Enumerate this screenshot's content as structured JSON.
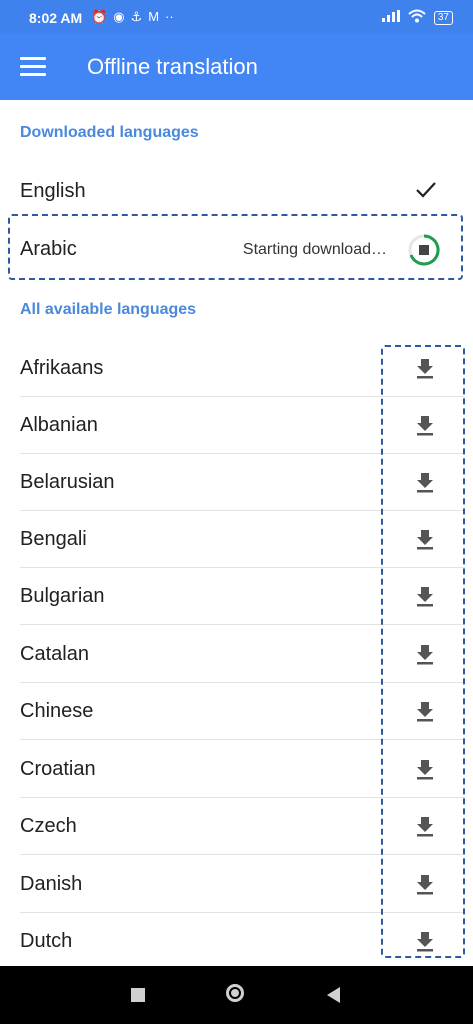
{
  "status_bar": {
    "time": "8:02 AM",
    "battery": "37",
    "icons": [
      "alarm-icon",
      "hotspot-icon",
      "usb-icon",
      "gmail-icon",
      "more-dots-icon",
      "signal-icon",
      "wifi-icon"
    ]
  },
  "app_bar": {
    "title": "Offline translation",
    "menu_icon": "hamburger-menu-icon"
  },
  "downloaded": {
    "header": "Downloaded languages",
    "items": [
      {
        "label": "English",
        "state": "downloaded",
        "icon": "check-icon"
      },
      {
        "label": "Arabic",
        "state": "downloading",
        "status_text": "Starting download…",
        "icon": "stop-progress-icon"
      }
    ]
  },
  "available": {
    "header": "All available languages",
    "items": [
      {
        "label": "Afrikaans",
        "icon": "download-icon"
      },
      {
        "label": "Albanian",
        "icon": "download-icon"
      },
      {
        "label": "Belarusian",
        "icon": "download-icon"
      },
      {
        "label": "Bengali",
        "icon": "download-icon"
      },
      {
        "label": "Bulgarian",
        "icon": "download-icon"
      },
      {
        "label": "Catalan",
        "icon": "download-icon"
      },
      {
        "label": "Chinese",
        "icon": "download-icon"
      },
      {
        "label": "Croatian",
        "icon": "download-icon"
      },
      {
        "label": "Czech",
        "icon": "download-icon"
      },
      {
        "label": "Danish",
        "icon": "download-icon"
      },
      {
        "label": "Dutch",
        "icon": "download-icon"
      }
    ]
  },
  "colors": {
    "app_bar": "#4285f4",
    "status_bar": "#3f82ee",
    "section_header": "#4a89dc",
    "progress": "#1e9e4a",
    "annotation_dash": "#2e5aa0"
  }
}
